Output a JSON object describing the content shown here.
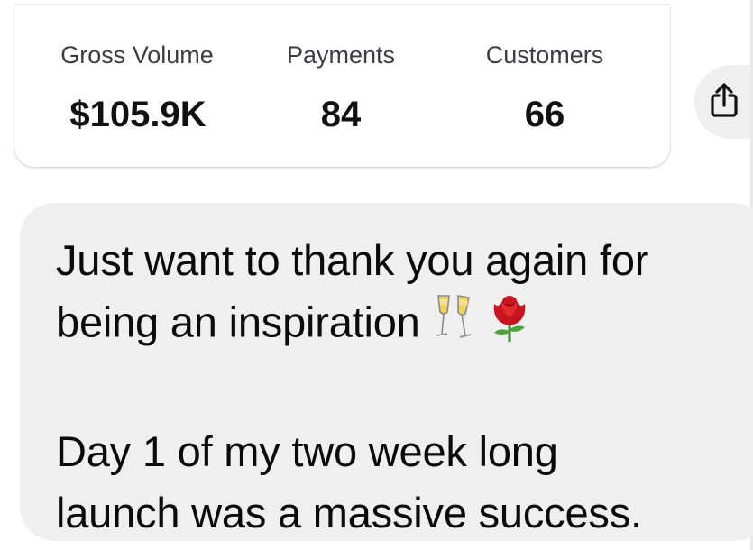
{
  "stats": [
    {
      "label": "Gross Volume",
      "value": "$105.9K"
    },
    {
      "label": "Payments",
      "value": "84"
    },
    {
      "label": "Customers",
      "value": "66"
    }
  ],
  "share": {
    "icon": "share-icon"
  },
  "message": {
    "paragraph1": {
      "line1": "Just want to thank you again for",
      "line2": "being an inspiration",
      "emojis": [
        "champagne-glasses-icon",
        "rose-icon"
      ]
    },
    "paragraph2": {
      "line1": "Day 1 of my two week long",
      "line2": "launch was a massive success."
    }
  },
  "colors": {
    "bubble": "#efefef",
    "text": "#0b0b0b",
    "label": "#3c3c43"
  }
}
